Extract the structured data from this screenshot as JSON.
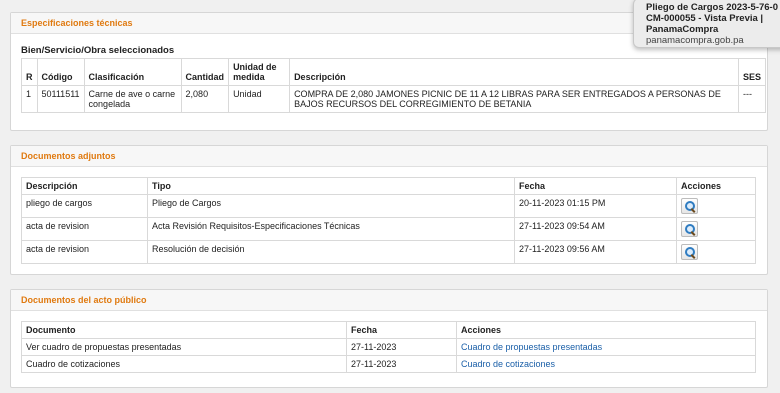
{
  "spec": {
    "header": "Especificaciones técnicas",
    "subtitle": "Bien/Servicio/Obra seleccionados",
    "columns": [
      "R",
      "Código",
      "Clasificación",
      "Cantidad",
      "Unidad de medida",
      "Descripción",
      "SES"
    ],
    "rows": [
      [
        "1",
        "50111511",
        "Carne de ave o carne congelada",
        "2,080",
        "Unidad",
        "COMPRA DE 2,080 JAMONES PICNIC DE 11 A 12 LIBRAS PARA SER ENTREGADOS A PERSONAS DE BAJOS RECURSOS DEL CORREGIMIENTO DE BETANIA",
        "---"
      ]
    ]
  },
  "adjuntos": {
    "header": "Documentos adjuntos",
    "columns": [
      "Descripción",
      "Tipo",
      "Fecha",
      "Acciones"
    ],
    "rows": [
      [
        "pliego de cargos",
        "Pliego de Cargos",
        "20-11-2023 01:15 PM"
      ],
      [
        "acta de revision",
        "Acta Revisión Requisitos-Especificaciones Técnicas",
        "27-11-2023 09:54 AM"
      ],
      [
        "acta de revision",
        "Resolución de decisión",
        "27-11-2023 09:56 AM"
      ]
    ]
  },
  "acto": {
    "header": "Documentos del acto público",
    "columns": [
      "Documento",
      "Fecha",
      "Acciones"
    ],
    "rows": [
      [
        "Ver cuadro de propuestas presentadas",
        "27-11-2023",
        "Cuadro de propuestas presentadas"
      ],
      [
        "Cuadro de cotizaciones",
        "27-11-2023",
        "Cuadro de cotizaciones"
      ]
    ]
  },
  "tooltip": {
    "title_lines": [
      "Pliego de Cargos 2023-5-76-0",
      "CM-000055 - Vista Previa |",
      "PanamaCompra"
    ],
    "url": "panamacompra.gob.pa"
  },
  "icons": {
    "action": "magnifier-icon"
  },
  "colors": {
    "section_header": "#e07a10",
    "link": "#1a5fa8",
    "page_bg": "#f0f0f0"
  }
}
